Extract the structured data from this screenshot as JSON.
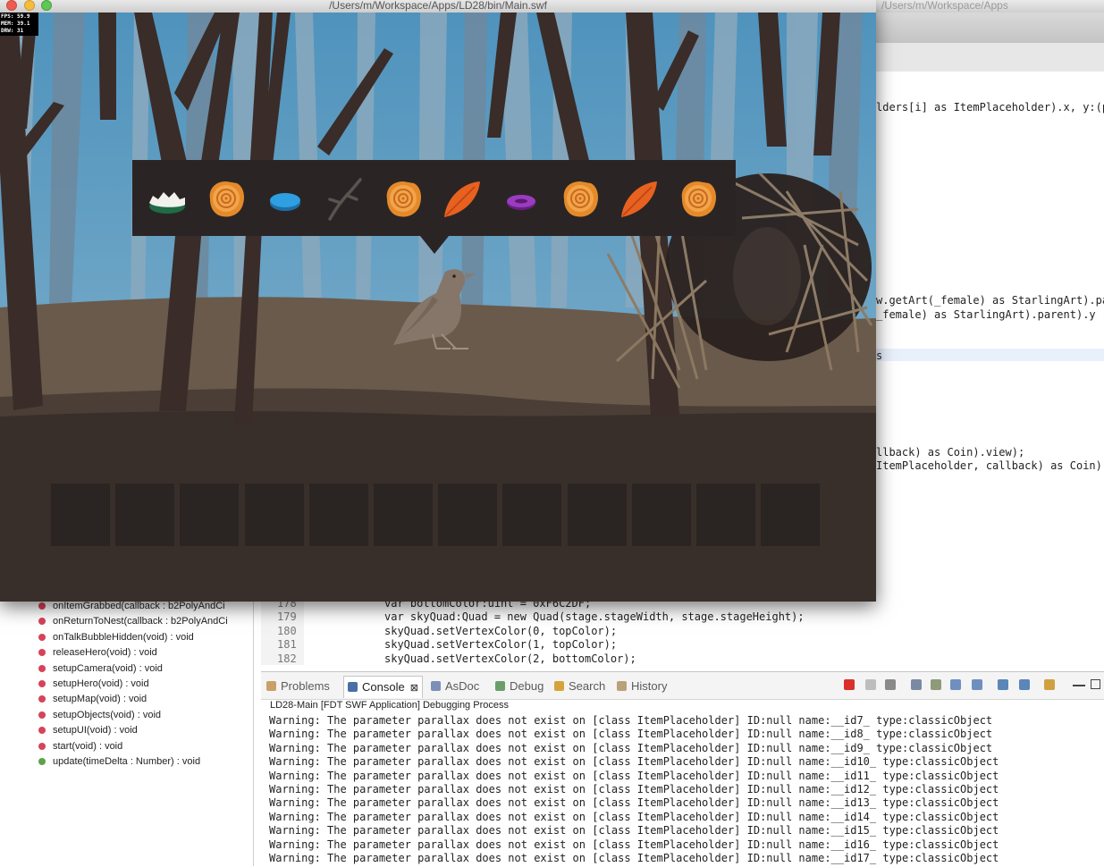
{
  "game": {
    "window_title": "/Users/m/Workspace/Apps/LD28/bin/Main.swf",
    "stats": [
      "FPS: 59.9",
      "MEM: 39.1",
      "DRW: 31"
    ],
    "inventory_items": [
      {
        "icon": "snow-pebble-icon"
      },
      {
        "icon": "wood-log-icon"
      },
      {
        "icon": "blue-gem-icon"
      },
      {
        "icon": "twig-icon"
      },
      {
        "icon": "wood-log-icon"
      },
      {
        "icon": "orange-leaf-icon"
      },
      {
        "icon": "purple-gem-icon"
      },
      {
        "icon": "wood-log-icon"
      },
      {
        "icon": "orange-leaf-icon"
      },
      {
        "icon": "wood-log-icon"
      }
    ],
    "empty_slot_count": 12,
    "colors": {
      "sky": "#5a9bc2",
      "ground": "#3a302b",
      "hill": "#6c5e50",
      "panel": "#2a2524",
      "leaf": "#e8611f",
      "log": "#e58a2a"
    }
  },
  "ide": {
    "right_title": "/Users/m/Workspace/Apps",
    "right_code": [
      {
        "text": "lders[i] as ItemPlaceholder).x, y:(p"
      },
      {
        "text": "w.getArt(_female) as StarlingArt).pa"
      },
      {
        "text": "_female) as StarlingArt).parent).y -"
      },
      {
        "text": "s"
      },
      {
        "text": "llback) as Coin).view);"
      },
      {
        "text": "ItemPlaceholder, callback) as Coin)."
      }
    ],
    "outline_items": [
      {
        "label": "onItemGrabbed(callback : b2PolyAndCi",
        "status": "red"
      },
      {
        "label": "onReturnToNest(callback : b2PolyAndCi",
        "status": "red"
      },
      {
        "label": "onTalkBubbleHidden(void) : void",
        "status": "red"
      },
      {
        "label": "releaseHero(void) : void",
        "status": "red"
      },
      {
        "label": "setupCamera(void) : void",
        "status": "red"
      },
      {
        "label": "setupHero(void) : void",
        "status": "red"
      },
      {
        "label": "setupMap(void) : void",
        "status": "red"
      },
      {
        "label": "setupObjects(void) : void",
        "status": "red"
      },
      {
        "label": "setupUI(void) : void",
        "status": "red"
      },
      {
        "label": "start(void) : void",
        "status": "red"
      },
      {
        "label": "update(timeDelta : Number) : void",
        "status": "green"
      }
    ],
    "editor_lines": [
      {
        "num": "178",
        "code": "var bottomColor:uint = 0xF6C2DF;"
      },
      {
        "num": "179",
        "code": "var skyQuad:Quad = new Quad(stage.stageWidth, stage.stageHeight);"
      },
      {
        "num": "180",
        "code": "skyQuad.setVertexColor(0, topColor);"
      },
      {
        "num": "181",
        "code": "skyQuad.setVertexColor(1, topColor);"
      },
      {
        "num": "182",
        "code": "skyQuad.setVertexColor(2, bottomColor);"
      }
    ],
    "console_tabs": [
      {
        "label": "Problems",
        "icon": "problems-icon"
      },
      {
        "label": "Console",
        "icon": "console-icon",
        "active": true
      },
      {
        "label": "AsDoc",
        "icon": "asdoc-icon"
      },
      {
        "label": "Debug",
        "icon": "debug-icon"
      },
      {
        "label": "Search",
        "icon": "search-icon"
      },
      {
        "label": "History",
        "icon": "history-icon"
      }
    ],
    "console_close": "⊠",
    "console_header": "LD28-Main [FDT SWF Application] Debugging Process",
    "console_lines": [
      "Warning: The parameter parallax does not exist on [class ItemPlaceholder] ID:null name:__id7_ type:classicObject",
      "Warning: The parameter parallax does not exist on [class ItemPlaceholder] ID:null name:__id8_ type:classicObject",
      "Warning: The parameter parallax does not exist on [class ItemPlaceholder] ID:null name:__id9_ type:classicObject",
      "Warning: The parameter parallax does not exist on [class ItemPlaceholder] ID:null name:__id10_ type:classicObject",
      "Warning: The parameter parallax does not exist on [class ItemPlaceholder] ID:null name:__id11_ type:classicObject",
      "Warning: The parameter parallax does not exist on [class ItemPlaceholder] ID:null name:__id12_ type:classicObject",
      "Warning: The parameter parallax does not exist on [class ItemPlaceholder] ID:null name:__id13_ type:classicObject",
      "Warning: The parameter parallax does not exist on [class ItemPlaceholder] ID:null name:__id14_ type:classicObject",
      "Warning: The parameter parallax does not exist on [class ItemPlaceholder] ID:null name:__id15_ type:classicObject",
      "Warning: The parameter parallax does not exist on [class ItemPlaceholder] ID:null name:__id16_ type:classicObject",
      "Warning: The parameter parallax does not exist on [class ItemPlaceholder] ID:null name:__id17_ type:classicObject"
    ]
  }
}
